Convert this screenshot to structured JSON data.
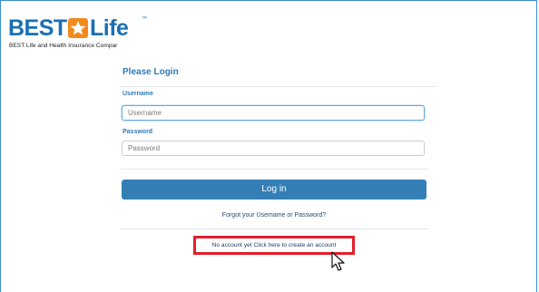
{
  "brand": {
    "name_part1": "BEST",
    "name_part2": "Life",
    "trademark": "™",
    "subtitle": "BEST Life and Health Insurance Compar",
    "primary_color": "#1b6fb3",
    "star_color": "#f28a1e"
  },
  "login": {
    "title": "Please Login",
    "username_label": "Username",
    "username_placeholder": "Username",
    "password_label": "Password",
    "password_placeholder": "Password",
    "submit_label": "Log in",
    "forgot_link": "Forgot your Usemame or Password?",
    "create_account_link": "No account yet Click here to create an account",
    "button_color": "#3480b6",
    "highlight_color": "#e21f2a"
  }
}
